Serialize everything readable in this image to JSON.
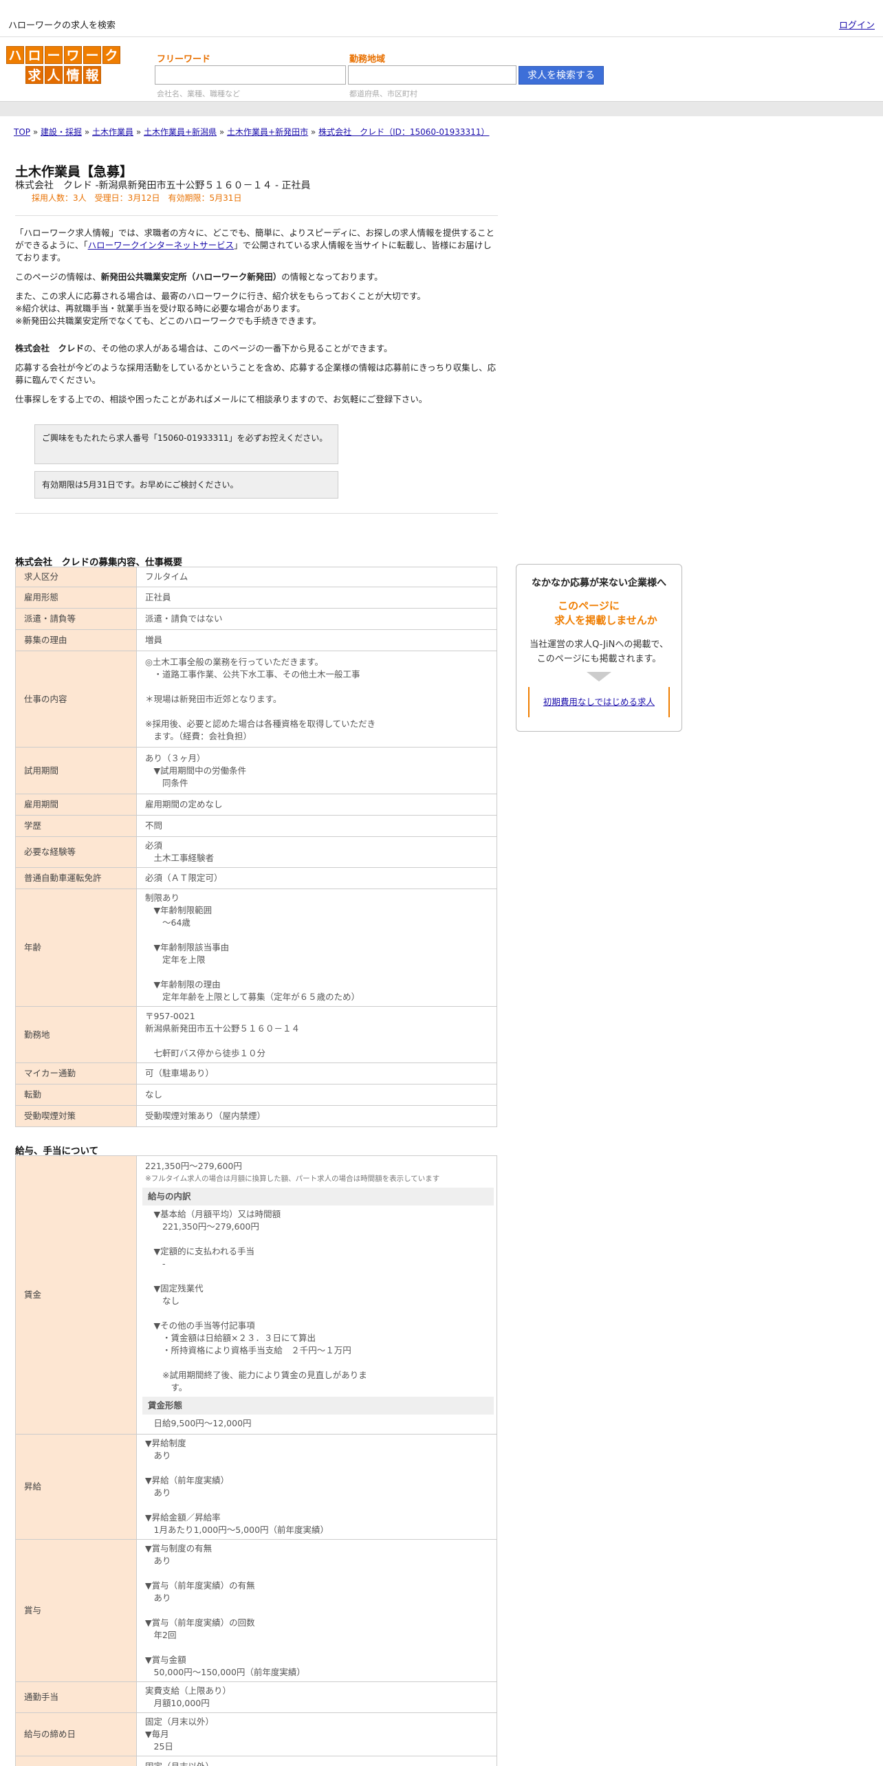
{
  "topbar": {
    "site": "ハローワークの求人を検索",
    "login": "ログイン"
  },
  "logo": {
    "row1": [
      "ハ",
      "ロ",
      "ー",
      "ワ",
      "ー",
      "ク"
    ],
    "row2": [
      "求",
      "人",
      "情",
      "報"
    ]
  },
  "search": {
    "free_label": "フリーワード",
    "free_ph": "会社名、業種、職種など",
    "area_label": "勤務地域",
    "area_ph": "都道府県、市区町村",
    "button": "求人を検索する"
  },
  "crumbs": [
    "TOP",
    "建設・採掘",
    "土木作業員",
    "土木作業員+新潟県",
    "土木作業員+新発田市",
    "株式会社　クレド（ID：15060-01933311）"
  ],
  "job": {
    "title": "土木作業員【急募】",
    "sub": "株式会社　クレド -新潟県新発田市五十公野５１６０－１４ - 正社員",
    "meta": "採用人数：3人　受理日：3月12日　有効期限：5月31日"
  },
  "intro": {
    "p1a": "「ハローワーク求人情報」では、求職者の方々に、どこでも、簡単に、よりスピーディに、お探しの求人情報を提供することができるように、「",
    "p1link": "ハローワークインターネットサービス",
    "p1b": "」で公開されている求人情報を当サイトに転載し、皆様にお届けしております。",
    "p2a": "このページの情報は、",
    "p2b": "新発田公共職業安定所（ハローワーク新発田）",
    "p2c": "の情報となっております。",
    "p3": "また、この求人に応募される場合は、最寄のハローワークに行き、紹介状をもらっておくことが大切です。\n※紹介状は、再就職手当・就業手当を受け取る時に必要な場合があります。\n※新発田公共職業安定所でなくても、どこのハローワークでも手続きできます。",
    "p4a": "株式会社　クレド",
    "p4b": "の、その他の求人がある場合は、このページの一番下から見ることができます。",
    "p5": "応募する会社が今どのような採用活動をしているかということを含め、応募する企業様の情報は応募前にきっちり収集し、応募に臨んでください。",
    "p6": "仕事探しをする上での、相談や困ったことがあればメールにて相談承りますので、お気軽にご登録下さい。"
  },
  "boxes": {
    "b1": "ご興味をもたれたら求人番号「15060-01933311」を必ずお控えください。",
    "b2": "有効期限は5月31日です。お早めにご検討ください。"
  },
  "section1": "株式会社　クレドの募集内容、仕事概要",
  "t1": [
    [
      "求人区分",
      "フルタイム"
    ],
    [
      "雇用形態",
      "正社員"
    ],
    [
      "派遣・請負等",
      "派遣・請負ではない"
    ],
    [
      "募集の理由",
      "増員"
    ],
    [
      "仕事の内容",
      "◎土木工事全般の業務を行っていただきます。\n　・道路工事作業、公共下水工事、その他土木一般工事\n\n＊現場は新発田市近郊となります。\n\n※採用後、必要と認めた場合は各種資格を取得していただき\n　ます。（経費：会社負担）"
    ],
    [
      "試用期間",
      "あり（３ヶ月）\n　▼試用期間中の労働条件\n　　同条件"
    ],
    [
      "雇用期間",
      "雇用期間の定めなし"
    ],
    [
      "学歴",
      "不問"
    ],
    [
      "必要な経験等",
      "必須\n　土木工事経験者"
    ],
    [
      "普通自動車運転免許",
      "必須（ＡＴ限定可）"
    ],
    [
      "年齢",
      "制限あり\n　▼年齢制限範囲\n　　〜64歳\n\n　▼年齢制限該当事由\n　　定年を上限\n\n　▼年齢制限の理由\n　　定年年齢を上限として募集（定年が６５歳のため）"
    ],
    [
      "勤務地",
      "〒957-0021\n新潟県新発田市五十公野５１６０－１４\n\n　七軒町バス停から徒歩１０分"
    ],
    [
      "マイカー通勤",
      "可（駐車場あり）"
    ],
    [
      "転勤",
      "なし"
    ],
    [
      "受動喫煙対策",
      "受動喫煙対策あり（屋内禁煙）"
    ]
  ],
  "section2": "給与、手当について",
  "wage": {
    "k": "賃金",
    "amount": "221,350円〜279,600円",
    "note": "※フルタイム求人の場合は月額に換算した額、パート求人の場合は時間額を表示しています",
    "h1": "給与の内訳",
    "body": "　▼基本給（月額平均）又は時間額\n　　221,350円〜279,600円\n\n　▼定額的に支払われる手当\n　　-\n\n　▼固定残業代\n　　なし\n\n　▼その他の手当等付記事項\n　　・賃金額は日給額×２３．３日にて算出\n　　・所持資格により資格手当支給　２千円～１万円\n\n　　※試用期間終了後、能力により賃金の見直しがありま\n　　　す。",
    "h2": "賃金形態",
    "form": "　日給9,500円〜12,000円"
  },
  "t2": [
    [
      "昇給",
      "▼昇給制度\n　あり\n\n▼昇給（前年度実績）\n　あり\n\n▼昇給金額／昇給率\n　1月あたり1,000円〜5,000円（前年度実績）"
    ],
    [
      "賞与",
      "▼賞与制度の有無\n　あり\n\n▼賞与（前年度実績）の有無\n　あり\n\n▼賞与（前年度実績）の回数\n　年2回\n\n▼賞与金額\n　50,000円〜150,000円（前年度実績）"
    ],
    [
      "通勤手当",
      "実費支給（上限あり）\n　月額10,000円"
    ],
    [
      "給与の締め日",
      "固定（月末以外）\n▼毎月\n　25日"
    ],
    [
      "",
      "固定（月末以外）"
    ]
  ],
  "ad": {
    "head": "なかなか応募が来ない企業様へ",
    "orange1": "このページに",
    "orange2": "求人を掲載しませんか",
    "text": "当社運営の求人Q-JiNへの掲載で、\nこのページにも掲載されます。",
    "link": "初期費用なしではじめる求人"
  }
}
